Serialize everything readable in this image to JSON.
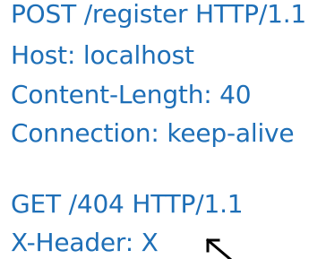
{
  "request_1": {
    "request_line": "POST /register HTTP/1.1",
    "host": "Host: localhost",
    "content_length": "Content-Length: 40",
    "connection": "Connection: keep-alive"
  },
  "request_2": {
    "request_line": "GET /404 HTTP/1.1",
    "x_header": "X-Header: X"
  },
  "colors": {
    "text": "#1e6fb7",
    "cursor": "#000000",
    "background": "#ffffff"
  },
  "icons": {
    "pointer": "mouse-pointer-icon"
  }
}
